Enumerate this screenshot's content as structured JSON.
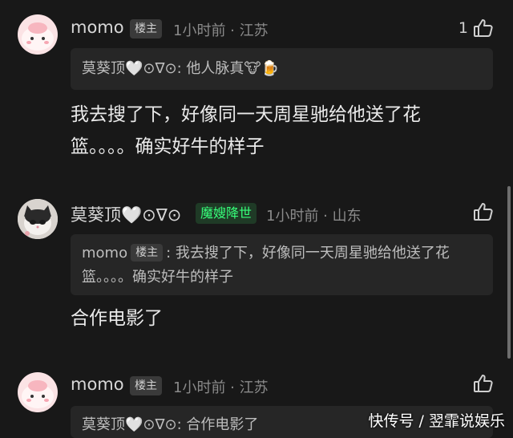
{
  "comments": [
    {
      "user": "momo",
      "host_tag": "楼主",
      "meta": "1小时前 · 江苏",
      "like_count": "1",
      "quote_author": "莫葵顶🤍⊙∇⊙",
      "quote_text": ": 他人脉真🐮🍺"
    },
    {
      "body": "我去搜了下，好像同一天周星驰给他送了花篮。。。。确实好牛的样子"
    },
    {
      "user": "莫葵顶🤍⊙∇⊙",
      "badge": "魔嫂降世",
      "meta": "1小时前 · 山东",
      "quote_author": "momo",
      "quote_host_tag": "楼主",
      "quote_text": ": 我去搜了下，好像同一天周星驰给他送了花篮。。。。确实好牛的样子",
      "body": "合作电影了"
    },
    {
      "user": "momo",
      "host_tag": "楼主",
      "meta": "1小时前 · 江苏",
      "quote_author": "莫葵顶🤍⊙∇⊙",
      "quote_text": ": 合作电影了"
    }
  ],
  "watermark": "快传号 / 翌霏说娱乐",
  "colors": {
    "background": "#181818",
    "badge_green": "#37ff7a"
  }
}
